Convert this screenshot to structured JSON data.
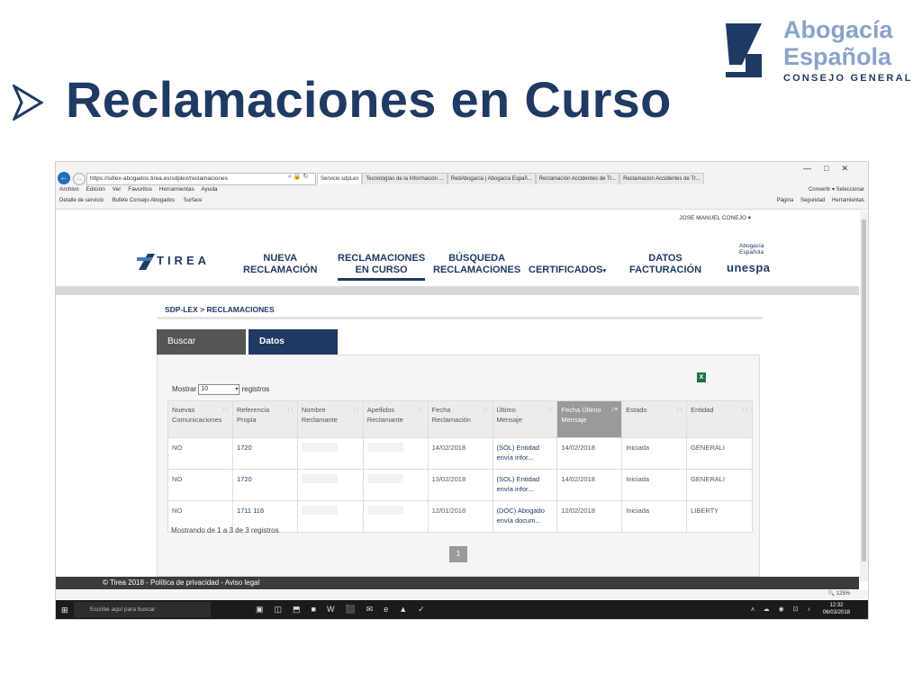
{
  "slide": {
    "title": "Reclamaciones en Curso",
    "logo": {
      "line1": "Abogacía",
      "line2": "Española",
      "line3": "CONSEJO GENERAL"
    }
  },
  "browser": {
    "address": "https://sdlex-abogados.tirea.es/sdplex/reclamaciones",
    "tabs": [
      "Servicio sdpLex",
      "Tecnologías de la Información ...",
      "RedAbogacía | Abogacía Españ...",
      "Reclamación Accidentes de Tr...",
      "Reclamación Accidentes de Tr..."
    ],
    "menu": [
      "Archivo",
      "Edición",
      "Ver",
      "Favoritos",
      "Herramientas",
      "Ayuda"
    ],
    "menu_right": [
      "Convertir",
      "Seleccionar"
    ],
    "favorites": [
      "Detalle de servicio",
      "Bufete Consejo Abogados",
      "Surface"
    ],
    "commands": [
      "Página",
      "Seguridad",
      "Herramientas"
    ]
  },
  "page": {
    "user": "JOSE MANUEL CONEJO",
    "brand": "TIREA",
    "nav": {
      "nueva_l1": "NUEVA",
      "nueva_l2": "RECLAMACIÓN",
      "curso_l1": "RECLAMACIONES",
      "curso_l2": "EN CURSO",
      "busq_l1": "BÚSQUEDA",
      "busq_l2": "RECLAMACIONES",
      "cert": "CERTIFICADOS",
      "datos_l1": "DATOS",
      "datos_l2": "FACTURACIÓN"
    },
    "partner": {
      "line1": "Abogacía",
      "line2": "Española",
      "unespa": "unespa"
    },
    "breadcrumb": "SDP-LEX > RECLAMACIONES",
    "tab_buscar": "Buscar",
    "tab_datos": "Datos",
    "excel_label": "X",
    "mostrar_label": "Mostrar",
    "mostrar_value": "10",
    "registros_label": "registros",
    "table": {
      "headers": [
        [
          "Nuevas",
          "Comunicaciones"
        ],
        [
          "Referencia",
          "Propia"
        ],
        [
          "Nombre",
          "Reclamante"
        ],
        [
          "Apellidos",
          "Reclamante"
        ],
        [
          "Fecha",
          "Reclamación"
        ],
        [
          "Último",
          "Mensaje"
        ],
        [
          "Fecha Último",
          "Mensaje"
        ],
        [
          "Estado",
          ""
        ],
        [
          "Entidad",
          ""
        ]
      ],
      "rows": [
        {
          "nuevas": "NO",
          "ref": "1720",
          "fecha": "14/02/2018",
          "msg1": "(SOL) Entidad",
          "msg2": "envía infor...",
          "fecha_ult": "14/02/2018",
          "estado": "Iniciada",
          "entidad": "GENERALI"
        },
        {
          "nuevas": "NO",
          "ref": "1720",
          "fecha": "13/02/2018",
          "msg1": "(SOL) Entidad",
          "msg2": "envía infor...",
          "fecha_ult": "14/02/2018",
          "estado": "Iniciada",
          "entidad": "GENERALI"
        },
        {
          "nuevas": "NO",
          "ref": "1711 116",
          "fecha": "12/01/2018",
          "msg1": "(DOC) Abogado",
          "msg2": "envía docum...",
          "fecha_ult": "12/02/2018",
          "estado": "Iniciada",
          "entidad": "LIBERTY"
        }
      ]
    },
    "showing": "Mostrando de 1 a 3 de 3 registros",
    "page_number": "1",
    "footer": "© Tirea 2018 - Política de privacidad - Aviso legal",
    "zoom": "125%"
  },
  "taskbar": {
    "search_placeholder": "Escribe aquí para buscar",
    "time": "12:32",
    "date": "06/03/2018"
  },
  "colors": {
    "primary": "#1f3a63",
    "accent": "#8aa3c8"
  }
}
